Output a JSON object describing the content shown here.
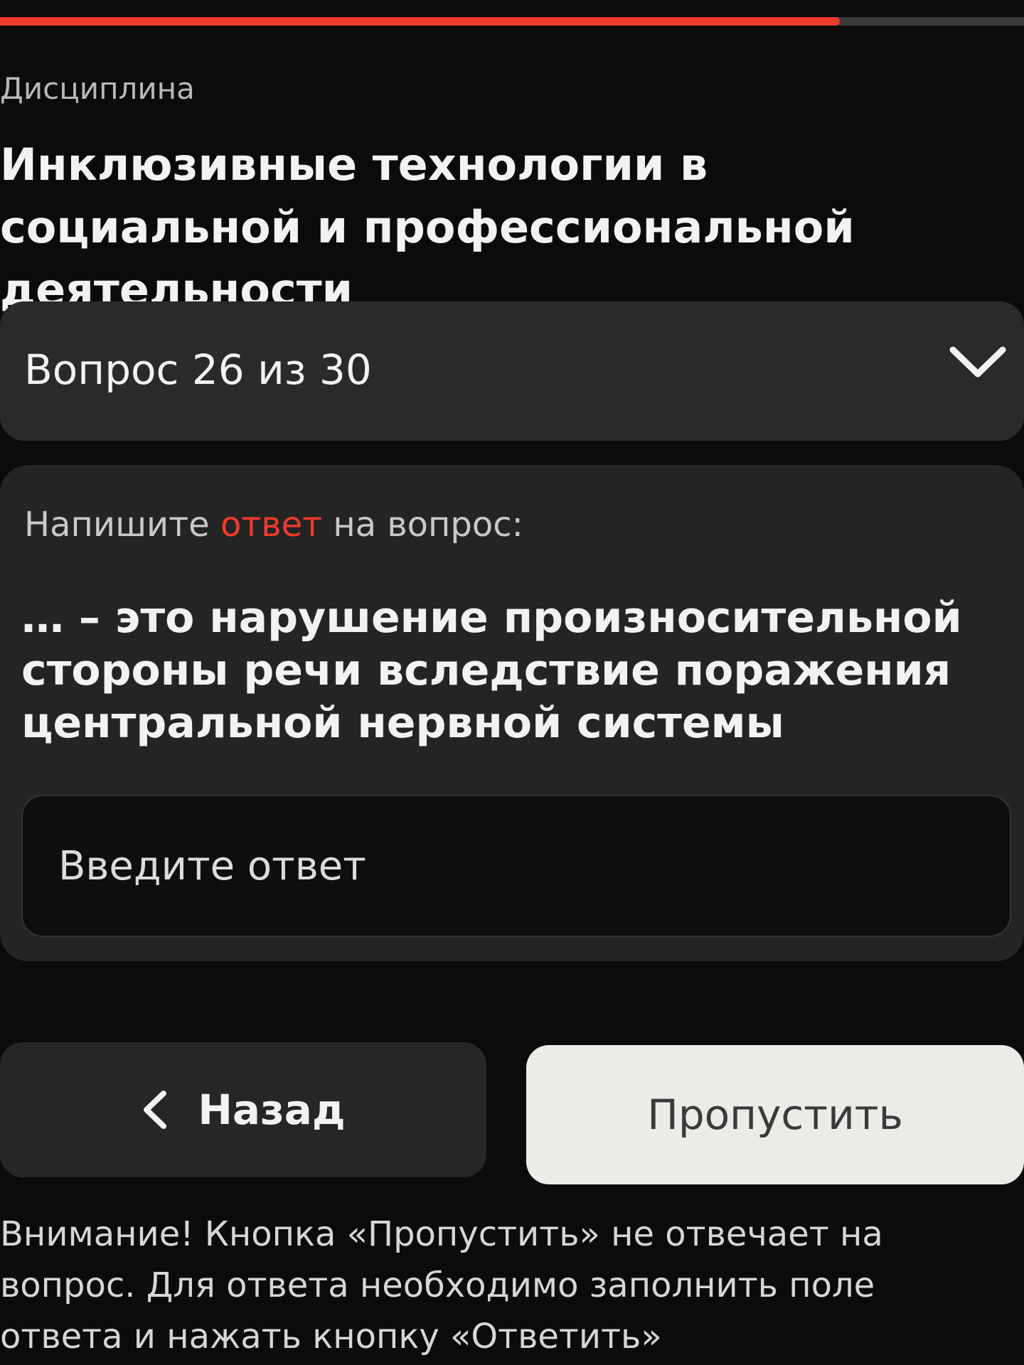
{
  "progress": {
    "fraction": 0.82,
    "color": "#f03a2c"
  },
  "discipline": {
    "label": "Дисциплина",
    "title": "Инклюзивные технологии в социальной и профессиональной деятельности"
  },
  "question_selector": {
    "label": "Вопрос 26 из 30",
    "icon": "chevron-down-icon"
  },
  "question": {
    "instruction_before": "Напишите ",
    "instruction_accent": "ответ",
    "instruction_after": " на вопрос:",
    "text": "… – это нарушение произносительной стороны речи вследствие поражения центральной нервной системы",
    "input_value": "",
    "input_placeholder": "Введите ответ"
  },
  "buttons": {
    "back_label": "Назад",
    "back_icon": "chevron-left-icon",
    "skip_label": "Пропустить"
  },
  "warning": "Внимание! Кнопка «Пропустить» не отвечает на вопрос. Для ответа необходимо заполнить поле ответа и нажать кнопку «Ответить»",
  "colors": {
    "accent": "#f03a2c",
    "background": "#0b0b0b",
    "card": "#242424",
    "skip_button": "#ecebe8"
  }
}
